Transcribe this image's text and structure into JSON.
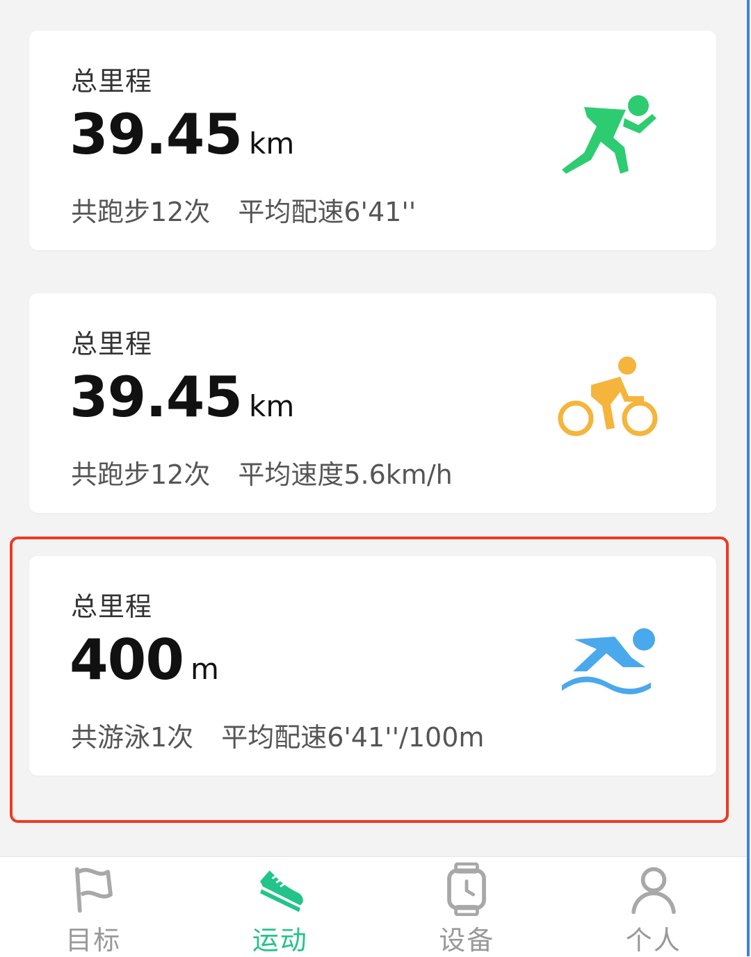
{
  "colors": {
    "run_icon": "#2ecc71",
    "bike_icon": "#f5b43c",
    "swim_icon": "#4aa8ec",
    "active_tab": "#22c48a",
    "inactive_tab": "#999999",
    "highlight_border": "#ee3a1f"
  },
  "cards": [
    {
      "label": "总里程",
      "value": "39.45",
      "unit": "km",
      "count_text": "共跑步12次",
      "metric_text": "平均配速6'41''",
      "icon": "running-icon"
    },
    {
      "label": "总里程",
      "value": "39.45",
      "unit": "km",
      "count_text": "共跑步12次",
      "metric_text": "平均速度5.6km/h",
      "icon": "cycling-icon"
    },
    {
      "label": "总里程",
      "value": "400",
      "unit": "m",
      "count_text": "共游泳1次",
      "metric_text": "平均配速6'41''/100m",
      "icon": "swimming-icon"
    }
  ],
  "tabbar": {
    "items": [
      {
        "label": "目标",
        "icon": "flag-icon",
        "active": false
      },
      {
        "label": "运动",
        "icon": "sneaker-icon",
        "active": true
      },
      {
        "label": "设备",
        "icon": "watch-icon",
        "active": false
      },
      {
        "label": "个人",
        "icon": "person-icon",
        "active": false
      }
    ]
  }
}
